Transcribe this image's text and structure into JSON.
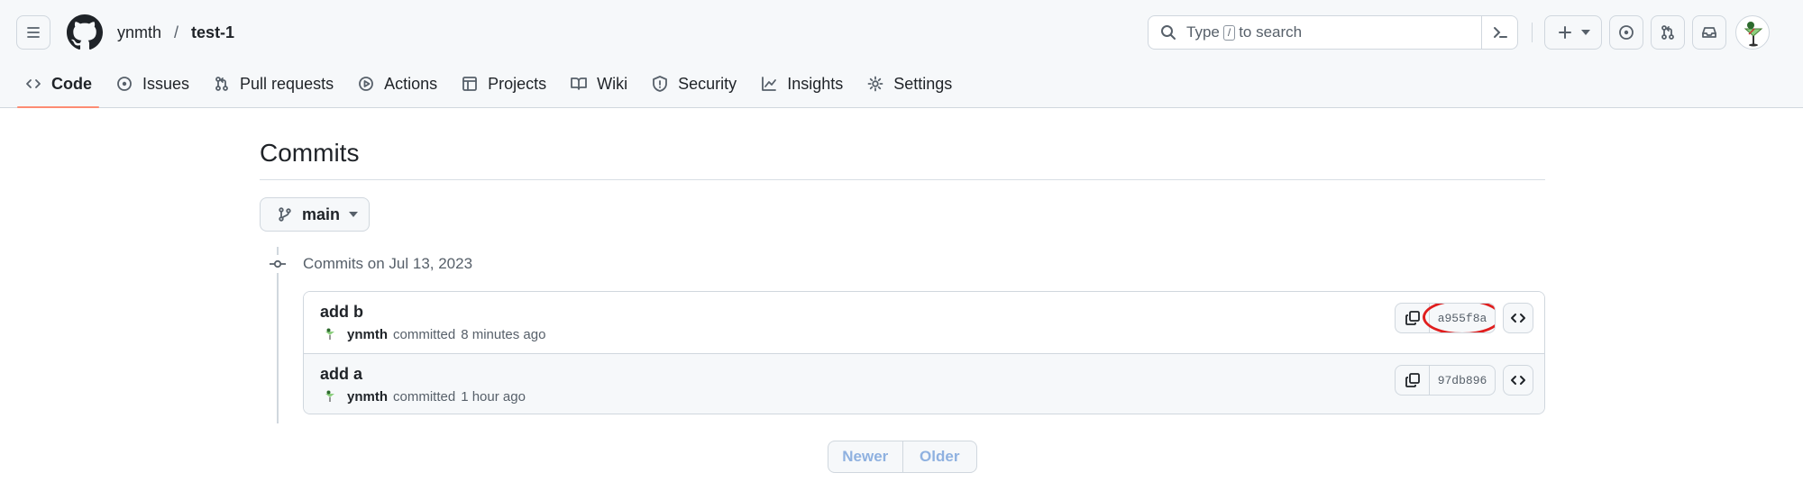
{
  "header": {
    "owner": "ynmth",
    "separator": "/",
    "repo": "test-1",
    "search": {
      "prefix": "Type",
      "key": "/",
      "suffix": "to search"
    }
  },
  "tabs": [
    {
      "label": "Code",
      "icon": "code-icon",
      "active": true
    },
    {
      "label": "Issues",
      "icon": "issue-icon"
    },
    {
      "label": "Pull requests",
      "icon": "git-pull-request-icon"
    },
    {
      "label": "Actions",
      "icon": "play-icon"
    },
    {
      "label": "Projects",
      "icon": "table-icon"
    },
    {
      "label": "Wiki",
      "icon": "book-icon"
    },
    {
      "label": "Security",
      "icon": "shield-icon"
    },
    {
      "label": "Insights",
      "icon": "graph-icon"
    },
    {
      "label": "Settings",
      "icon": "gear-icon"
    }
  ],
  "main": {
    "title": "Commits",
    "branch": "main",
    "group_date": "Commits on Jul 13, 2023",
    "commits": [
      {
        "message": "add b",
        "author": "ynmth",
        "action": "committed",
        "time": "8 minutes ago",
        "sha": "a955f8a",
        "highlighted": true
      },
      {
        "message": "add a",
        "author": "ynmth",
        "action": "committed",
        "time": "1 hour ago",
        "sha": "97db896",
        "highlighted": false
      }
    ],
    "pagination": {
      "newer": "Newer",
      "older": "Older"
    }
  },
  "colors": {
    "accent_underline": "#fd8c73",
    "highlight_ring": "#e01e1e",
    "disabled_link": "#8fb1e0"
  }
}
